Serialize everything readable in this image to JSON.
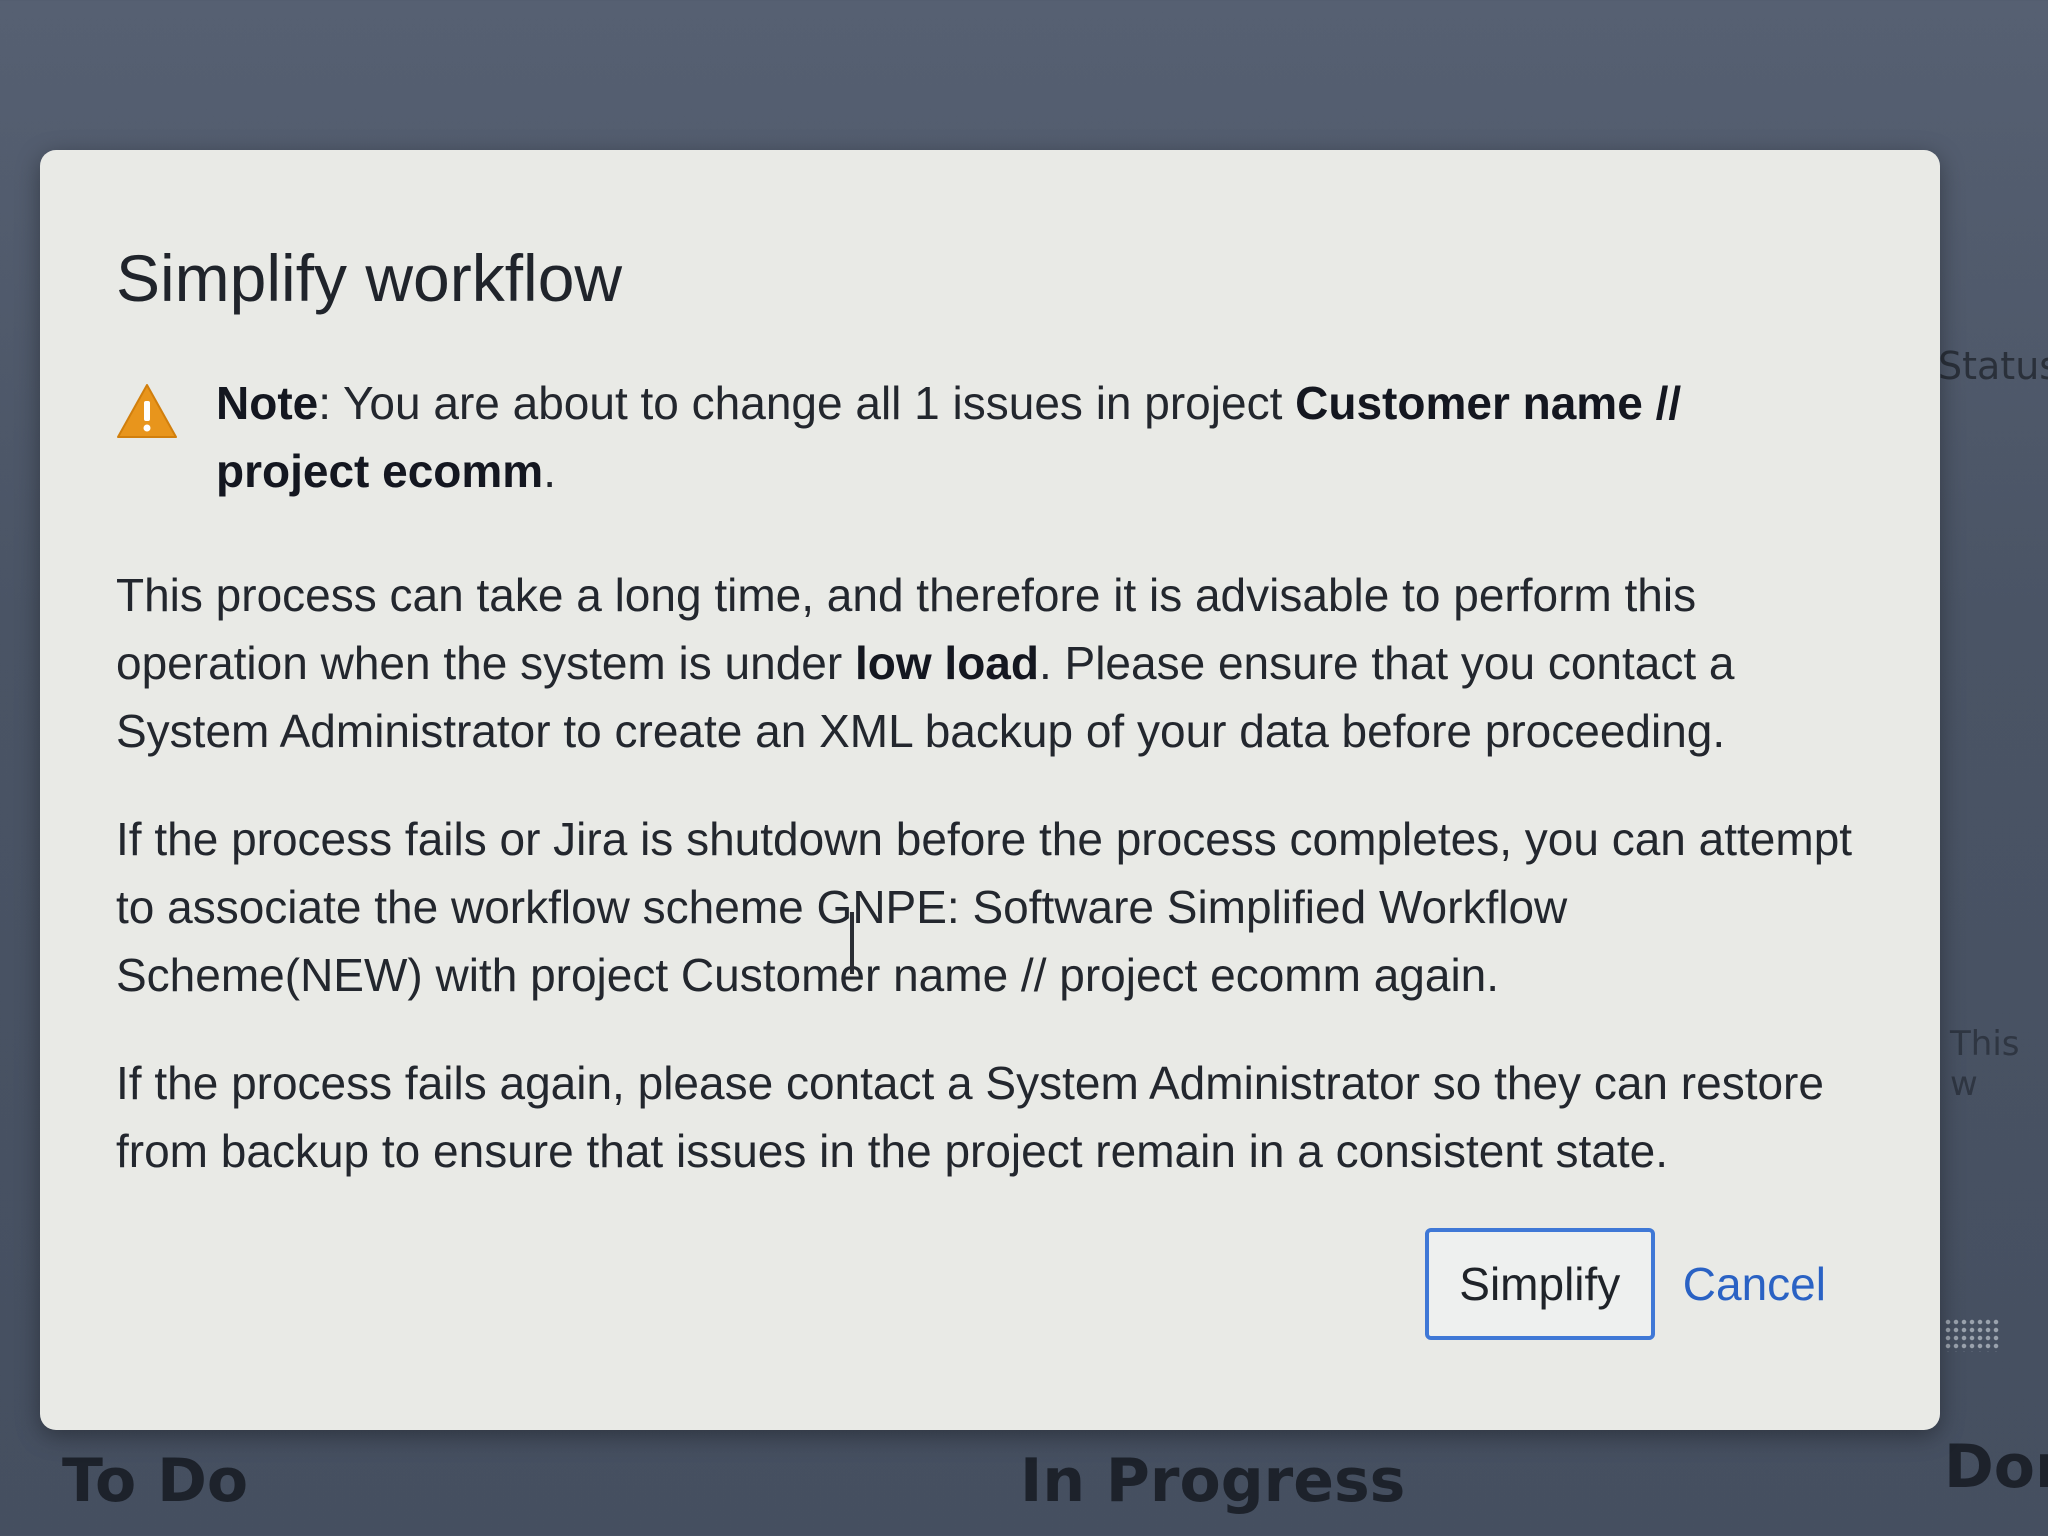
{
  "background": {
    "status_label": "Status",
    "this_label": "This w",
    "columns": [
      "To Do",
      "In Progress",
      "Dor"
    ]
  },
  "dialog": {
    "title": "Simplify workflow",
    "note": {
      "label": "Note",
      "text_before": ": You are about to change all 1 issues in project ",
      "project_name": "Customer name // project ecomm",
      "text_after": "."
    },
    "paragraph1": {
      "text_before": "This process can take a long time, and therefore it is advisable to perform this operation when the system is under ",
      "emphasis": "low load",
      "text_after": ". Please ensure that you contact a System Administrator to create an XML backup of your data before proceeding."
    },
    "paragraph2": "If the process fails or Jira is shutdown before the process completes, you can attempt to associate the workflow scheme GNPE: Software Simplified Workflow Scheme(NEW) with project Customer name // project ecomm again.",
    "paragraph3": "If the process fails again, please contact a System Administrator so they can restore from backup to ensure that issues in the project remain in a consistent state.",
    "primary_button": "Simplify",
    "cancel_button": "Cancel"
  },
  "icons": {
    "warning": "warning-icon",
    "drag": "drag-handle-icon"
  },
  "colors": {
    "primary_border": "#3f78d6",
    "link": "#2a62c4",
    "warning": "#e8951c"
  }
}
